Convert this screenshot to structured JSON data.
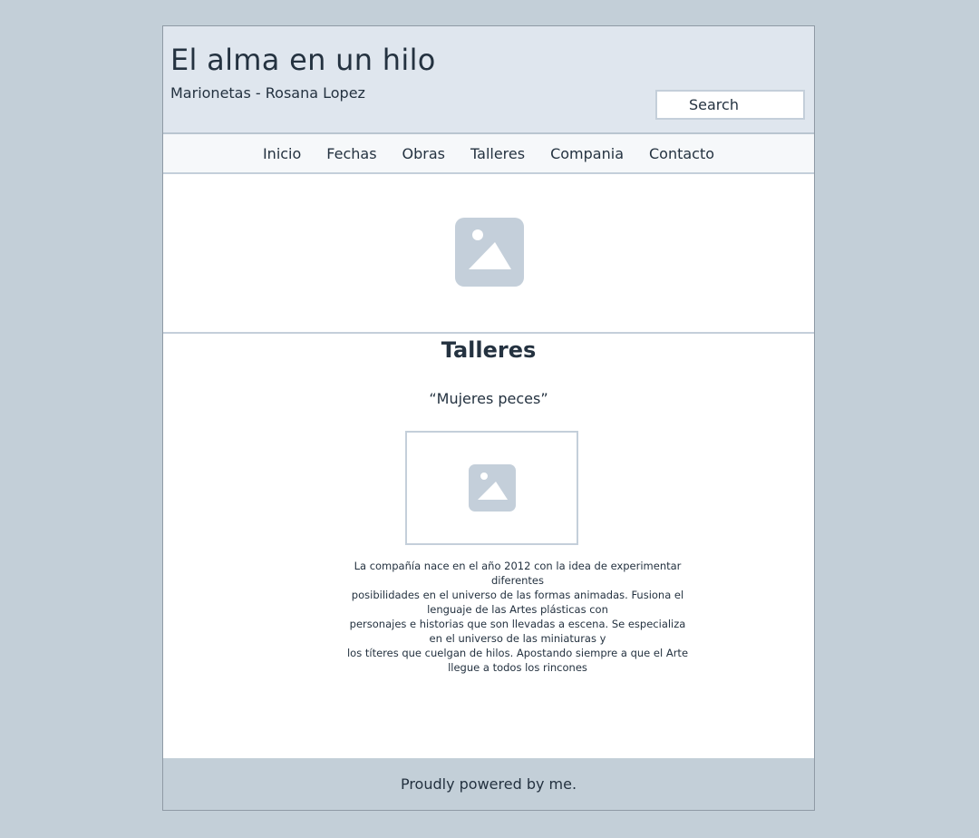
{
  "header": {
    "title": "El alma en un hilo",
    "subtitle": "Marionetas - Rosana Lopez",
    "search_placeholder": "Search"
  },
  "nav": {
    "items": [
      {
        "label": "Inicio"
      },
      {
        "label": "Fechas"
      },
      {
        "label": "Obras"
      },
      {
        "label": "Talleres"
      },
      {
        "label": "Compania"
      },
      {
        "label": "Contacto"
      }
    ]
  },
  "hero": {
    "icon": "image-icon"
  },
  "main": {
    "title": "Talleres",
    "quote": "“Mujeres peces”",
    "image_icon": "image-icon",
    "description_lines": [
      "La compañía nace en el año 2012 con la idea de experimentar",
      "diferentes",
      "posibilidades en el universo de las formas animadas. Fusiona el",
      "lenguaje de las Artes plásticas con",
      "personajes e historias que son llevadas a escena. Se especializa",
      "en el universo de las miniaturas y",
      "los títeres que cuelgan de hilos. Apostando siempre a que el Arte",
      "llegue a todos los rincones"
    ]
  },
  "footer": {
    "text": "Proudly powered by me."
  },
  "colors": {
    "background": "#c3cfd8",
    "header_bg": "#dfe6ee",
    "nav_bg": "#f6f8fa",
    "text": "#243240",
    "placeholder_icon": "#c4cfda",
    "footer_bg": "#c3cfd8"
  }
}
